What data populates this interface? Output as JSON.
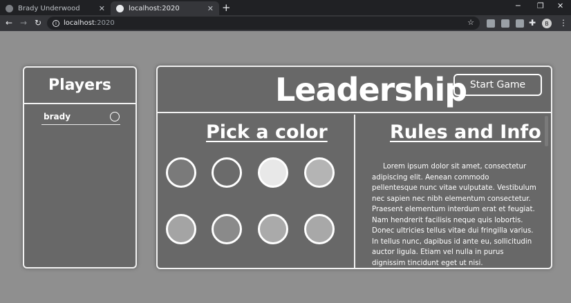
{
  "browser": {
    "tabs": [
      {
        "title": "Brady Underwood",
        "active": false
      },
      {
        "title": "localhost:2020",
        "active": true
      }
    ],
    "url_host": "localhost",
    "url_port": ":2020",
    "profile_initial": "B"
  },
  "players": {
    "title": "Players",
    "list": [
      {
        "name": "brady"
      }
    ]
  },
  "header": {
    "title": "Leadership",
    "start_button": "Start Game"
  },
  "color_picker": {
    "heading": "Pick a color",
    "swatches": [
      "#7a7a7a",
      "#6b6b6b",
      "#e8e8e8",
      "#b4b4b4",
      "#a4a4a4",
      "#8a8a8a",
      "#aaaaaa",
      "#a8a8a8"
    ]
  },
  "rules": {
    "heading": "Rules and Info",
    "text": "Lorem ipsum dolor sit amet, consectetur adipiscing elit. Aenean commodo pellentesque nunc vitae vulputate. Vestibulum nec sapien nec nibh elementum consectetur. Praesent elementum interdum erat et feugiat. Nam hendrerit facilisis neque quis lobortis. Donec ultricies tellus vitae dui fringilla varius. In tellus nunc, dapibus id ante eu, sollicitudin auctor ligula. Etiam vel nulla in purus dignissim tincidunt eget ut nisi."
  }
}
